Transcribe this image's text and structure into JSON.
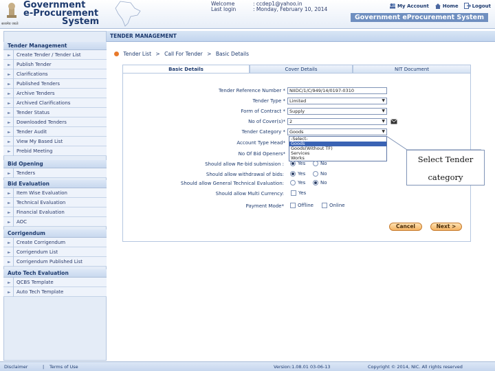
{
  "header": {
    "logo_lines": [
      "Government",
      "e-Procurement",
      "System"
    ],
    "emblem_caption": "सत्यमेव जयते",
    "welcome_label": "Welcome",
    "welcome_value": ": ccdep1@yahoo.in",
    "last_login_label": "Last login",
    "last_login_value": ": Monday, February 10, 2014",
    "my_account": "My Account",
    "home": "Home",
    "logout": "Logout",
    "system_title": "Government eProcurement System"
  },
  "banner": {
    "title": "TENDER MANAGEMENT"
  },
  "sidebar": {
    "sections": [
      {
        "title": "Tender Management",
        "items": [
          "Create Tender / Tender List",
          "Publish Tender",
          "Clarifications",
          "Published Tenders",
          "Archive Tenders",
          "Archived Clarifications",
          "Tender Status",
          "Downloaded Tenders",
          "Tender Audit",
          "View My Based List",
          "Prebid Meeting"
        ]
      },
      {
        "title": "Bid Opening",
        "items": [
          "Tenders"
        ]
      },
      {
        "title": "Bid Evaluation",
        "items": [
          "Item Wise Evaluation",
          "Technical Evaluation",
          "Financial Evaluation",
          "AOC"
        ]
      },
      {
        "title": "Corrigendum",
        "items": [
          "Create Corrigendum",
          "Corrigendum List",
          "Corrigendum Published List"
        ]
      },
      {
        "title": "Auto Tech Evaluation",
        "items": [
          "QCBS Template",
          "Auto Tech Template"
        ]
      }
    ]
  },
  "breadcrumb": {
    "items": [
      "Tender List",
      "Call For Tender",
      "Basic Details"
    ],
    "separator": ">"
  },
  "tabs": [
    "Basic Details",
    "Cover Details",
    "NIT Document"
  ],
  "form": {
    "tender_ref_label": "Tender Reference Number *",
    "tender_ref_value": "NIIDC/1/C/949/14/0197-0310",
    "tender_type_label": "Tender Type *",
    "tender_type_value": "Limited",
    "form_contract_label": "Form of Contract *",
    "form_contract_value": "Supply",
    "covers_label": "No of Cover(s)*",
    "covers_value": "2",
    "category_label": "Tender Category *",
    "category_value": "Goods",
    "category_options": [
      "-Select-",
      "Goods",
      "Goods(Without TF)",
      "Services",
      "Works"
    ],
    "category_selected_index": 1,
    "account_type_label": "Account Type Head*",
    "bid_openers_label": "No Of Bid Openers*",
    "rebid_label": "Should allow Re-bid submission :",
    "withdrawal_label": "Should allow withdrawal of bids:",
    "general_tech_label": "Should allow General Technical Evaluation:",
    "multi_currency_label": "Should allow Multi Currency:",
    "payment_mode_label": "Payment Mode*",
    "yes": "Yes",
    "no": "No",
    "offline": "Offline",
    "online": "Online"
  },
  "callout": {
    "line1": "Select Tender",
    "line2": "category"
  },
  "buttons": {
    "cancel": "Cancel",
    "next": "Next >"
  },
  "footer": {
    "disclaimer": "Disclaimer",
    "terms": "Terms of Use",
    "version": "Version:1.08.01 03-06-13",
    "copyright": "Copyright © 2014, NIC. All rights reserved"
  },
  "colors": {
    "accent": "#1d3a6e",
    "highlight": "#3a63b4",
    "button": "#f4b262",
    "bullet": "#e8792a"
  }
}
